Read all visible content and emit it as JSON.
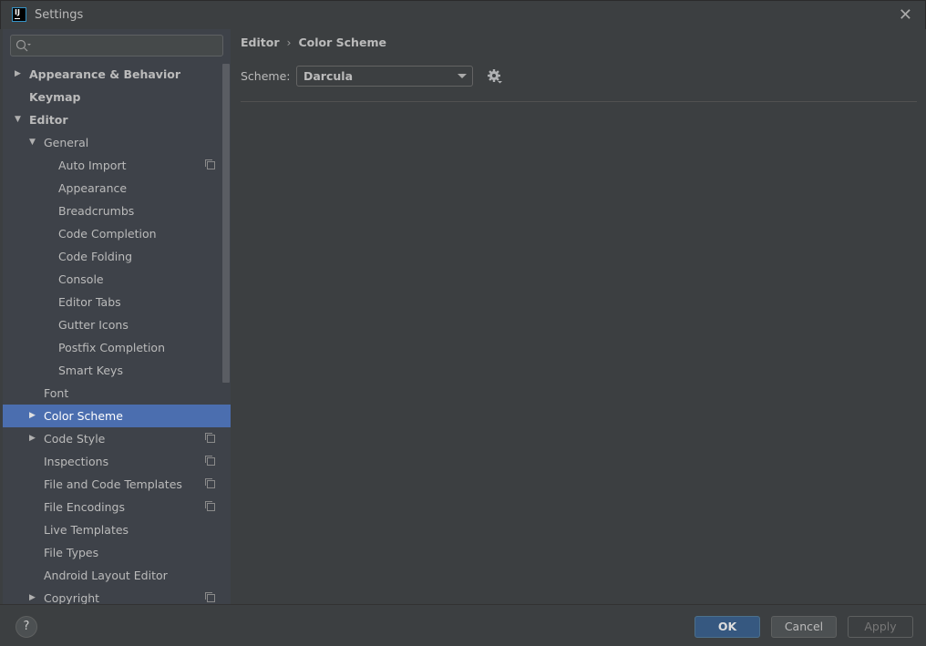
{
  "window": {
    "title": "Settings",
    "logo": "IJ"
  },
  "search": {
    "placeholder": ""
  },
  "tree": [
    {
      "label": "Appearance & Behavior",
      "level": 0,
      "bold": true,
      "arrow": "right"
    },
    {
      "label": "Keymap",
      "level": 0,
      "bold": true,
      "arrow": ""
    },
    {
      "label": "Editor",
      "level": 0,
      "bold": true,
      "arrow": "down"
    },
    {
      "label": "General",
      "level": 1,
      "arrow": "down"
    },
    {
      "label": "Auto Import",
      "level": 2,
      "copy": true
    },
    {
      "label": "Appearance",
      "level": 2
    },
    {
      "label": "Breadcrumbs",
      "level": 2
    },
    {
      "label": "Code Completion",
      "level": 2
    },
    {
      "label": "Code Folding",
      "level": 2
    },
    {
      "label": "Console",
      "level": 2
    },
    {
      "label": "Editor Tabs",
      "level": 2
    },
    {
      "label": "Gutter Icons",
      "level": 2
    },
    {
      "label": "Postfix Completion",
      "level": 2
    },
    {
      "label": "Smart Keys",
      "level": 2
    },
    {
      "label": "Font",
      "level": 1
    },
    {
      "label": "Color Scheme",
      "level": 1,
      "arrow": "right",
      "selected": true
    },
    {
      "label": "Code Style",
      "level": 1,
      "arrow": "right",
      "copy": true
    },
    {
      "label": "Inspections",
      "level": 1,
      "copy": true
    },
    {
      "label": "File and Code Templates",
      "level": 1,
      "copy": true
    },
    {
      "label": "File Encodings",
      "level": 1,
      "copy": true
    },
    {
      "label": "Live Templates",
      "level": 1
    },
    {
      "label": "File Types",
      "level": 1
    },
    {
      "label": "Android Layout Editor",
      "level": 1
    },
    {
      "label": "Copyright",
      "level": 1,
      "arrow": "right",
      "copy": true
    }
  ],
  "breadcrumb": {
    "parent": "Editor",
    "separator": "›",
    "current": "Color Scheme"
  },
  "scheme": {
    "label": "Scheme:",
    "value": "Darcula"
  },
  "footer": {
    "help": "?",
    "ok": "OK",
    "cancel": "Cancel",
    "apply": "Apply"
  },
  "colors": {
    "selection": "#4b6eaf",
    "ok_button": "#365880"
  }
}
